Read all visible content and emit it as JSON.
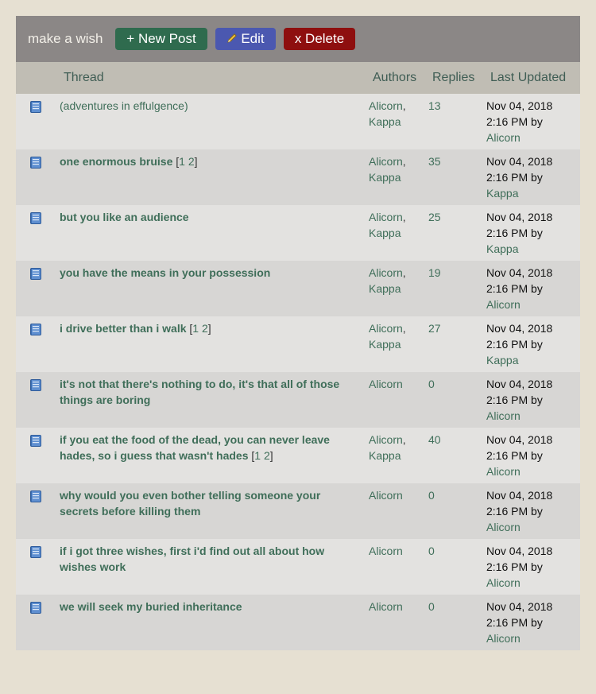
{
  "toolbar": {
    "title": "make a wish",
    "new_post_label": "+ New Post",
    "edit_label": "Edit",
    "delete_label": "x Delete"
  },
  "columns": {
    "thread": "Thread",
    "authors": "Authors",
    "replies": "Replies",
    "last_updated": "Last Updated"
  },
  "rows": [
    {
      "title": "(adventures in effulgence)",
      "bold": false,
      "pages": [],
      "authors": [
        "Alicorn",
        "Kappa"
      ],
      "replies": "13",
      "date": "Nov 04, 2018",
      "time": "2:16 PM by",
      "by": "Alicorn"
    },
    {
      "title": "one enormous bruise",
      "bold": true,
      "pages": [
        "1",
        "2"
      ],
      "authors": [
        "Alicorn",
        "Kappa"
      ],
      "replies": "35",
      "date": "Nov 04, 2018",
      "time": "2:16 PM by",
      "by": "Kappa"
    },
    {
      "title": "but you like an audience",
      "bold": true,
      "pages": [],
      "authors": [
        "Alicorn",
        "Kappa"
      ],
      "replies": "25",
      "date": "Nov 04, 2018",
      "time": "2:16 PM by",
      "by": "Kappa"
    },
    {
      "title": "you have the means in your possession",
      "bold": true,
      "pages": [],
      "authors": [
        "Alicorn",
        "Kappa"
      ],
      "replies": "19",
      "date": "Nov 04, 2018",
      "time": "2:16 PM by",
      "by": "Alicorn"
    },
    {
      "title": "i drive better than i walk",
      "bold": true,
      "pages": [
        "1",
        "2"
      ],
      "authors": [
        "Alicorn",
        "Kappa"
      ],
      "replies": "27",
      "date": "Nov 04, 2018",
      "time": "2:16 PM by",
      "by": "Kappa"
    },
    {
      "title": "it's not that there's nothing to do, it's that all of those things are boring",
      "bold": true,
      "pages": [],
      "authors": [
        "Alicorn"
      ],
      "replies": "0",
      "date": "Nov 04, 2018",
      "time": "2:16 PM by",
      "by": "Alicorn"
    },
    {
      "title": "if you eat the food of the dead, you can never leave hades, so i guess that wasn't hades",
      "bold": true,
      "pages": [
        "1",
        "2"
      ],
      "authors": [
        "Alicorn",
        "Kappa"
      ],
      "replies": "40",
      "date": "Nov 04, 2018",
      "time": "2:16 PM by",
      "by": "Alicorn"
    },
    {
      "title": "why would you even bother telling someone your secrets before killing them",
      "bold": true,
      "pages": [],
      "authors": [
        "Alicorn"
      ],
      "replies": "0",
      "date": "Nov 04, 2018",
      "time": "2:16 PM by",
      "by": "Alicorn"
    },
    {
      "title": "if i got three wishes, first i'd find out all about how wishes work",
      "bold": true,
      "pages": [],
      "authors": [
        "Alicorn"
      ],
      "replies": "0",
      "date": "Nov 04, 2018",
      "time": "2:16 PM by",
      "by": "Alicorn"
    },
    {
      "title": "we will seek my buried inheritance",
      "bold": true,
      "pages": [],
      "authors": [
        "Alicorn"
      ],
      "replies": "0",
      "date": "Nov 04, 2018",
      "time": "2:16 PM by",
      "by": "Alicorn"
    }
  ]
}
